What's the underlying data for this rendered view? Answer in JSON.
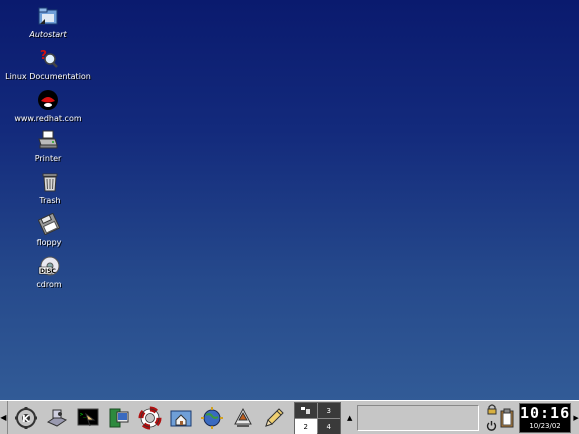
{
  "desktop": {
    "icons": [
      {
        "label": "Autostart",
        "icon": "folder-icon"
      },
      {
        "label": "Linux Documentation",
        "icon": "help-icon"
      },
      {
        "label": "www.redhat.com",
        "icon": "redhat-icon"
      },
      {
        "label": "Printer",
        "icon": "printer-icon"
      },
      {
        "label": "Trash",
        "icon": "trash-icon"
      },
      {
        "label": "floppy",
        "icon": "floppy-icon"
      },
      {
        "label": "cdrom",
        "icon": "cdrom-icon"
      }
    ],
    "background_top": "#0a1a6e",
    "background_bottom": "#35609a"
  },
  "panel": {
    "hide_left": "◀",
    "launchers": [
      "kde-menu-icon",
      "control-center-icon",
      "terminal-icon",
      "system-icon",
      "help-lifebuoy-icon",
      "home-folder-icon",
      "web-browser-icon",
      "office-icon",
      "editor-icon"
    ],
    "pager": {
      "desktops": [
        "",
        "3",
        "2",
        "4"
      ],
      "active": 2
    },
    "taskbar_arrow": "▲",
    "clock": {
      "time": "10:16",
      "date": "10/23/02"
    },
    "hide_right": "▶"
  }
}
